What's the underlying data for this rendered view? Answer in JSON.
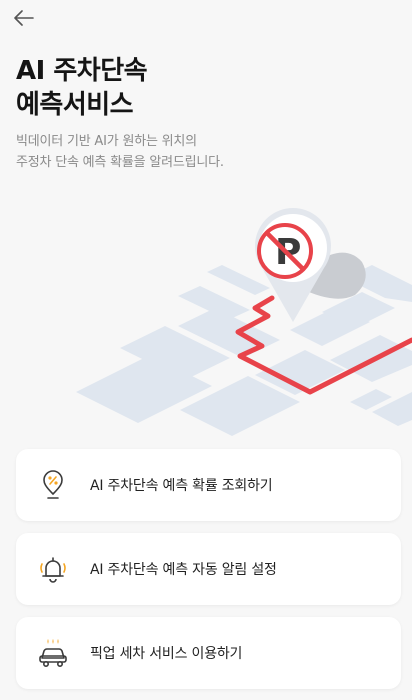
{
  "header": {
    "back_icon": "arrow-left-icon",
    "title_line1": "AI 주차단속",
    "title_line2": "예측서비스",
    "subtitle_line1": "빅데이터 기반 AI가 원하는 위치의",
    "subtitle_line2": "주정차 단속 예측 확률을 알려드립니다."
  },
  "illustration": {
    "pin_icon": "no-parking-pin-icon",
    "route_color": "#e8434a",
    "block_color": "#dfe6ef"
  },
  "menu": {
    "items": [
      {
        "label": "AI 주차단속 예측 확률 조회하기",
        "icon": "percent-pin-icon"
      },
      {
        "label": "AI 주차단속 예측 자동 알림 설정",
        "icon": "bell-alert-icon"
      },
      {
        "label": "픽업 세차 서비스 이용하기",
        "icon": "car-wash-icon"
      }
    ]
  },
  "colors": {
    "accent": "#e8434a",
    "icon_stroke": "#3b3b3b",
    "icon_accent": "#f5a623"
  }
}
